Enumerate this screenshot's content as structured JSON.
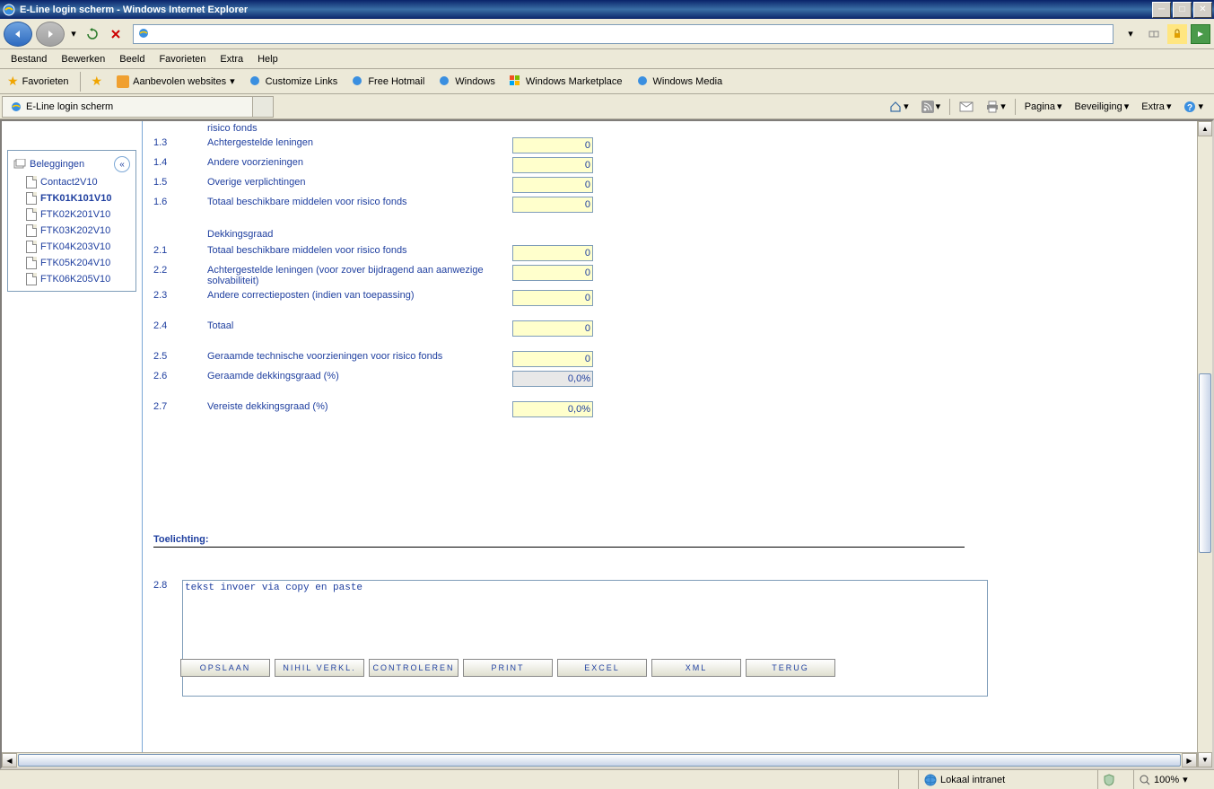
{
  "window": {
    "title": "E-Line login scherm - Windows Internet Explorer"
  },
  "menubar": [
    "Bestand",
    "Bewerken",
    "Beeld",
    "Favorieten",
    "Extra",
    "Help"
  ],
  "favbar": {
    "favorieten": "Favorieten",
    "aanbevolen": "Aanbevolen websites",
    "links": [
      "Customize Links",
      "Free Hotmail",
      "Windows",
      "Windows Marketplace",
      "Windows Media"
    ]
  },
  "tab": {
    "title": "E-Line login scherm"
  },
  "cmdbar": {
    "pagina": "Pagina",
    "beveiliging": "Beveiliging",
    "extra": "Extra"
  },
  "tree": {
    "root": "Beleggingen",
    "items": [
      "Contact2V10",
      "FTK01K101V10",
      "FTK02K201V10",
      "FTK03K202V10",
      "FTK04K203V10",
      "FTK05K204V10",
      "FTK06K205V10"
    ],
    "activeIndex": 1
  },
  "form": {
    "rows1": [
      {
        "num": "",
        "label": "risico fonds",
        "val": ""
      },
      {
        "num": "1.3",
        "label": "Achtergestelde leningen",
        "val": "0"
      },
      {
        "num": "1.4",
        "label": "Andere voorzieningen",
        "val": "0"
      },
      {
        "num": "1.5",
        "label": "Overige verplichtingen",
        "val": "0"
      },
      {
        "num": "1.6",
        "label": "Totaal beschikbare middelen voor risico fonds",
        "val": "0"
      }
    ],
    "section2_title": "Dekkingsgraad",
    "rows2": [
      {
        "num": "2.1",
        "label": "Totaal beschikbare middelen voor risico fonds",
        "val": "0"
      },
      {
        "num": "2.2",
        "label": "Achtergestelde leningen (voor zover bijdragend aan aanwezige solvabiliteit)",
        "val": "0"
      },
      {
        "num": "2.3",
        "label": "Andere correctieposten (indien van toepassing)",
        "val": "0"
      }
    ],
    "row24": {
      "num": "2.4",
      "label": "Totaal",
      "val": "0"
    },
    "rows3": [
      {
        "num": "2.5",
        "label": "Geraamde technische voorzieningen voor risico fonds",
        "val": "0",
        "cls": ""
      },
      {
        "num": "2.6",
        "label": "Geraamde dekkingsgraad (%)",
        "val": "0,0%",
        "cls": "gray"
      }
    ],
    "row27": {
      "num": "2.7",
      "label": "Vereiste dekkingsgraad (%)",
      "val": "0,0%"
    },
    "toelichting_title": "Toelichting:",
    "row28num": "2.8",
    "textarea_value": "tekst invoer via copy en paste"
  },
  "buttons": [
    "OPSLAAN",
    "NIHIL VERKL.",
    "CONTROLEREN",
    "PRINT",
    "EXCEL",
    "XML",
    "TERUG"
  ],
  "statusbar": {
    "zone": "Lokaal intranet",
    "zoom": "100%"
  }
}
